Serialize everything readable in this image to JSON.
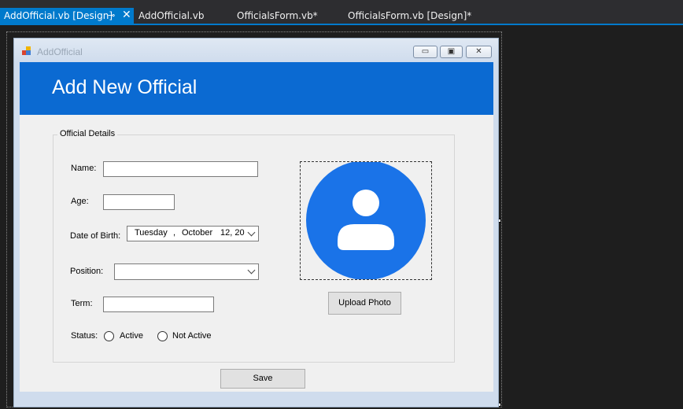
{
  "tabs": [
    {
      "label": "AddOfficial.vb [Design]",
      "active": true
    },
    {
      "label": "AddOfficial.vb"
    },
    {
      "label": "OfficialsForm.vb*"
    },
    {
      "label": "OfficialsForm.vb [Design]*"
    }
  ],
  "tab_icons": {
    "pin": "⊸",
    "close": "✕"
  },
  "window": {
    "title": "AddOfficial",
    "buttons": {
      "minimize": "▭",
      "maximize": "▣",
      "close": "✕"
    }
  },
  "header": {
    "title": "Add New Official"
  },
  "group": {
    "label": "Official Details"
  },
  "fields": {
    "name_label": "Name:",
    "name_value": "",
    "age_label": "Age:",
    "age_value": "",
    "dob_label": "Date of Birth:",
    "dob_weekday": "Tuesday",
    "dob_sep": ",",
    "dob_month": "October",
    "dob_day": "12, 20",
    "position_label": "Position:",
    "position_value": "",
    "term_label": "Term:",
    "term_value": "",
    "status_label": "Status:",
    "status_options": [
      "Active",
      "Not Active"
    ]
  },
  "buttons": {
    "upload": "Upload Photo",
    "save": "Save"
  },
  "colors": {
    "accent": "#007acc",
    "header": "#0b6ad2",
    "avatar": "#1a73e8"
  }
}
